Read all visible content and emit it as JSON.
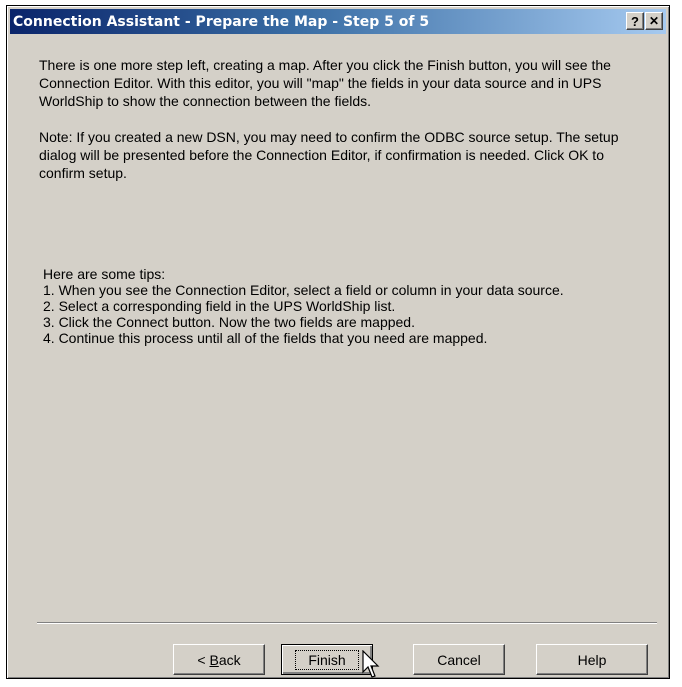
{
  "window": {
    "title": "Connection Assistant - Prepare the Map - Step 5 of 5",
    "help_button": "?",
    "close_button": "✕"
  },
  "body": {
    "intro": "There is one more step left, creating a map. After you click the Finish button, you will see the Connection Editor. With this editor, you will \"map\" the fields in your data source and in UPS WorldShip to show the connection between the fields.",
    "note": "Note: If you created a new DSN, you may need to confirm the ODBC source setup. The setup dialog will be presented before the Connection Editor, if confirmation is needed.  Click OK to confirm setup.",
    "tips_heading": "Here are some tips:",
    "tips": [
      "1. When you see the Connection Editor, select a field or column in your data source.",
      "2. Select a corresponding field in the  UPS WorldShip list.",
      "3. Click the Connect button. Now the two fields are mapped.",
      "4. Continue this process until all of the fields that you need are mapped."
    ]
  },
  "buttons": {
    "back_prefix": "< ",
    "back_mnemonic": "B",
    "back_rest": "ack",
    "finish": "Finish",
    "cancel": "Cancel",
    "help": "Help"
  }
}
